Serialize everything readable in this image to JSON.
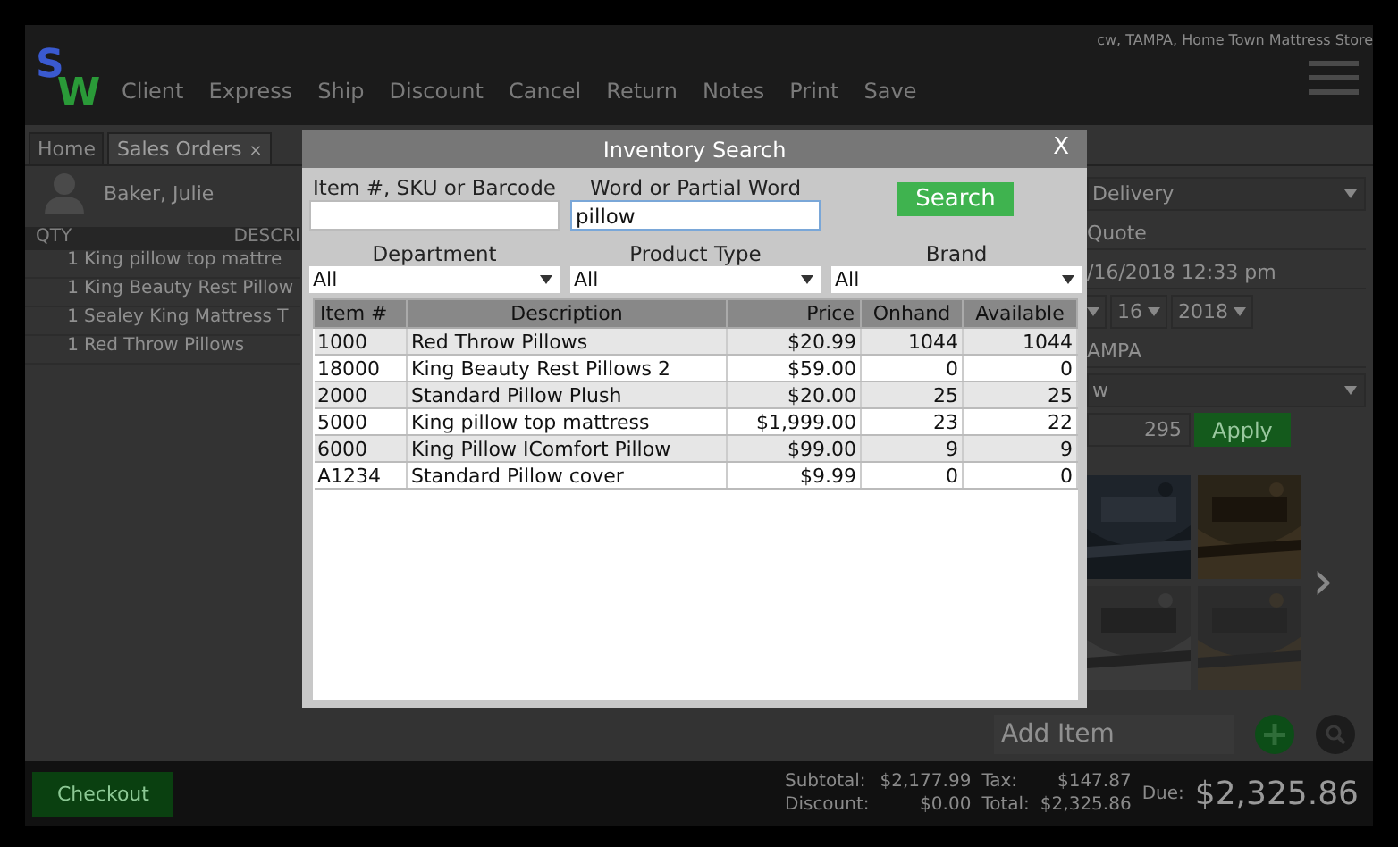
{
  "header": {
    "logo": [
      "S",
      "W"
    ],
    "nav": [
      "Client",
      "Express",
      "Ship",
      "Discount",
      "Cancel",
      "Return",
      "Notes",
      "Print",
      "Save"
    ],
    "store": "cw, TAMPA, Home Town Mattress Store"
  },
  "tabs": [
    {
      "label": "Home",
      "selected": false
    },
    {
      "label": "Sales Orders",
      "selected": true,
      "close": "×"
    }
  ],
  "customer": {
    "name": "Baker, Julie"
  },
  "order_table": {
    "columns": [
      "QTY",
      "DESCRI"
    ],
    "rows": [
      {
        "qty": "1",
        "description": "King pillow top mattre"
      },
      {
        "qty": "1",
        "description": "King Beauty Rest Pillow"
      },
      {
        "qty": "1",
        "description": "Sealey King Mattress T"
      },
      {
        "qty": "1",
        "description": "Red Throw Pillows"
      }
    ]
  },
  "order_details": [
    {
      "kind": "select",
      "value": "Delivery"
    },
    {
      "kind": "text",
      "value": "Quote"
    },
    {
      "kind": "text",
      "value": "/16/2018 12:33 pm"
    },
    {
      "kind": "date",
      "parts": [
        "16",
        "2018"
      ]
    },
    {
      "kind": "text",
      "value": "AMPA"
    },
    {
      "kind": "select",
      "value": "w"
    },
    {
      "kind": "discount",
      "value": "295",
      "button": "Apply"
    }
  ],
  "gallery": {
    "next": "›"
  },
  "add_item": {
    "placeholder": "Add Item"
  },
  "footer": {
    "checkout": "Checkout",
    "totals": [
      {
        "label": "Subtotal:",
        "value": "$2,177.99"
      },
      {
        "label": "Tax:",
        "value": "$147.87"
      },
      {
        "label": "Discount:",
        "value": "$0.00"
      },
      {
        "label": "Total:",
        "value": "$2,325.86"
      }
    ],
    "due_label": "Due:",
    "due": "$2,325.86"
  },
  "dialog": {
    "title": "Inventory Search",
    "close": "X",
    "item_field": {
      "label": "Item #, SKU or Barcode"
    },
    "word_field": {
      "label": "Word or Partial Word",
      "value": "pillow"
    },
    "search_button": "Search",
    "filters": [
      {
        "label": "Department",
        "value": "All"
      },
      {
        "label": "Product Type",
        "value": "All"
      },
      {
        "label": "Brand",
        "value": "All"
      }
    ],
    "table": {
      "columns": [
        "Item #",
        "Description",
        "Price",
        "Onhand",
        "Available"
      ],
      "rows": [
        [
          "1000",
          "Red Throw Pillows",
          "$20.99",
          "1044",
          "1044"
        ],
        [
          "18000",
          "King Beauty Rest Pillows 2",
          "$59.00",
          "0",
          "0"
        ],
        [
          "2000",
          "Standard Pillow Plush",
          "$20.00",
          "25",
          "25"
        ],
        [
          "5000",
          "King pillow top mattress",
          "$1,999.00",
          "23",
          "22"
        ],
        [
          "6000",
          "King Pillow IComfort Pillow",
          "$99.00",
          "9",
          "9"
        ],
        [
          "A1234",
          "Standard Pillow cover",
          "$9.99",
          "0",
          "0"
        ]
      ]
    }
  }
}
